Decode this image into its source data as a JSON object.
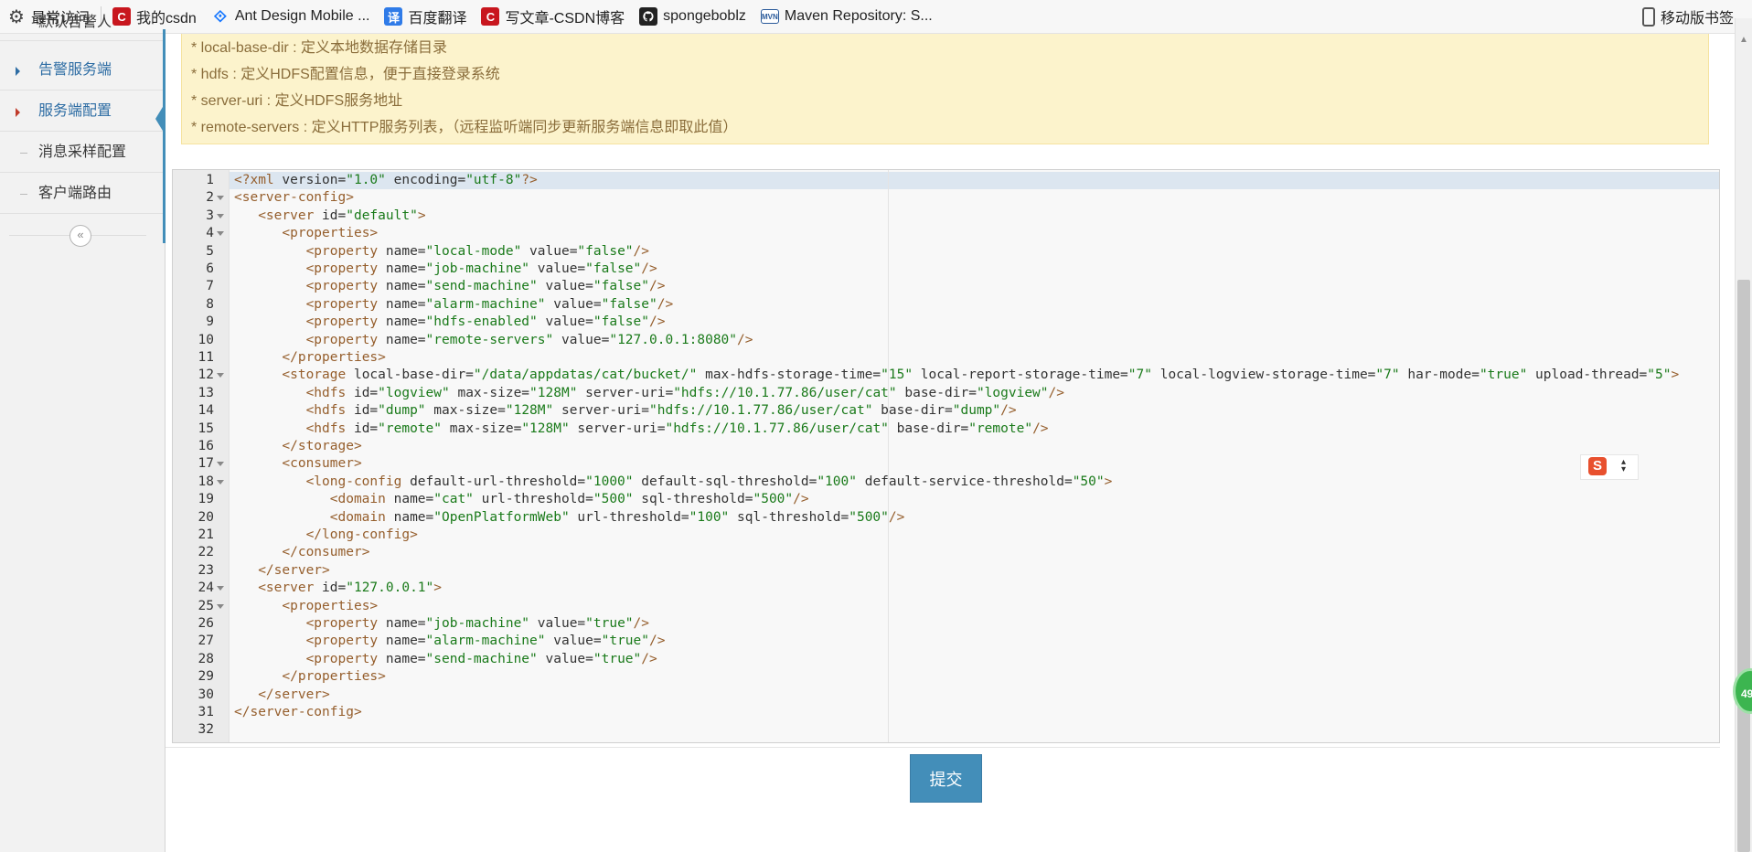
{
  "bookmarks": {
    "items": [
      {
        "label": "最常访问",
        "icon": "gear-icon"
      },
      {
        "label": "我的csdn",
        "icon": "csdn-icon"
      },
      {
        "label": "Ant Design Mobile ...",
        "icon": "ant-design-icon"
      },
      {
        "label": "百度翻译",
        "icon": "baidu-translate-icon"
      },
      {
        "label": "写文章-CSDN博客",
        "icon": "csdn-icon"
      },
      {
        "label": "spongeboblz",
        "icon": "github-icon"
      },
      {
        "label": "Maven Repository: S...",
        "icon": "maven-icon"
      }
    ],
    "mobile_label": "移动版书签",
    "icon_glyphs": {
      "csdn": "C",
      "fanyi": "译",
      "mvn": "MVN",
      "ant": "⟐"
    }
  },
  "sidebar": {
    "items": [
      {
        "label": "默认告警人"
      },
      {
        "label": "告警服务端"
      },
      {
        "label": "服务端配置"
      },
      {
        "label": "消息采样配置"
      },
      {
        "label": "客户端路由"
      }
    ],
    "collapse_glyph": "«"
  },
  "notice": {
    "lines": [
      "* local-base-dir : 定义本地数据存储目录",
      "* hdfs : 定义HDFS配置信息，便于直接登录系统",
      "* server-uri : 定义HDFS服务地址",
      "* remote-servers : 定义HTTP服务列表，（远程监听端同步更新服务端信息即取此值）"
    ]
  },
  "editor": {
    "language": "xml",
    "active_line": 1,
    "lines": [
      "<?xml version=\"1.0\" encoding=\"utf-8\"?>",
      "<server-config>",
      "   <server id=\"default\">",
      "      <properties>",
      "         <property name=\"local-mode\" value=\"false\"/>",
      "         <property name=\"job-machine\" value=\"false\"/>",
      "         <property name=\"send-machine\" value=\"false\"/>",
      "         <property name=\"alarm-machine\" value=\"false\"/>",
      "         <property name=\"hdfs-enabled\" value=\"false\"/>",
      "         <property name=\"remote-servers\" value=\"127.0.0.1:8080\"/>",
      "      </properties>",
      "      <storage local-base-dir=\"/data/appdatas/cat/bucket/\" max-hdfs-storage-time=\"15\" local-report-storage-time=\"7\" local-logview-storage-time=\"7\" har-mode=\"true\" upload-thread=\"5\">",
      "         <hdfs id=\"logview\" max-size=\"128M\" server-uri=\"hdfs://10.1.77.86/user/cat\" base-dir=\"logview\"/>",
      "         <hdfs id=\"dump\" max-size=\"128M\" server-uri=\"hdfs://10.1.77.86/user/cat\" base-dir=\"dump\"/>",
      "         <hdfs id=\"remote\" max-size=\"128M\" server-uri=\"hdfs://10.1.77.86/user/cat\" base-dir=\"remote\"/>",
      "      </storage>",
      "      <consumer>",
      "         <long-config default-url-threshold=\"1000\" default-sql-threshold=\"100\" default-service-threshold=\"50\">",
      "            <domain name=\"cat\" url-threshold=\"500\" sql-threshold=\"500\"/>",
      "            <domain name=\"OpenPlatformWeb\" url-threshold=\"100\" sql-threshold=\"500\"/>",
      "         </long-config>",
      "      </consumer>",
      "   </server>",
      "   <server id=\"127.0.0.1\">",
      "      <properties>",
      "         <property name=\"job-machine\" value=\"true\"/>",
      "         <property name=\"alarm-machine\" value=\"true\"/>",
      "         <property name=\"send-machine\" value=\"true\"/>",
      "      </properties>",
      "   </server>",
      "</server-config>",
      ""
    ],
    "fold_lines": [
      2,
      3,
      4,
      12,
      17,
      18,
      24,
      25
    ]
  },
  "float_tool": {
    "glyph": "S",
    "dropdown_glyph": "▴\n▾"
  },
  "submit": {
    "label": "提交"
  },
  "badge": {
    "value": "49"
  },
  "colors": {
    "accent": "#438eb9",
    "notice_bg": "#fcf3cc",
    "notice_text": "#8a6d3b",
    "tag": "#955e2c",
    "value": "#1a7a1a"
  }
}
